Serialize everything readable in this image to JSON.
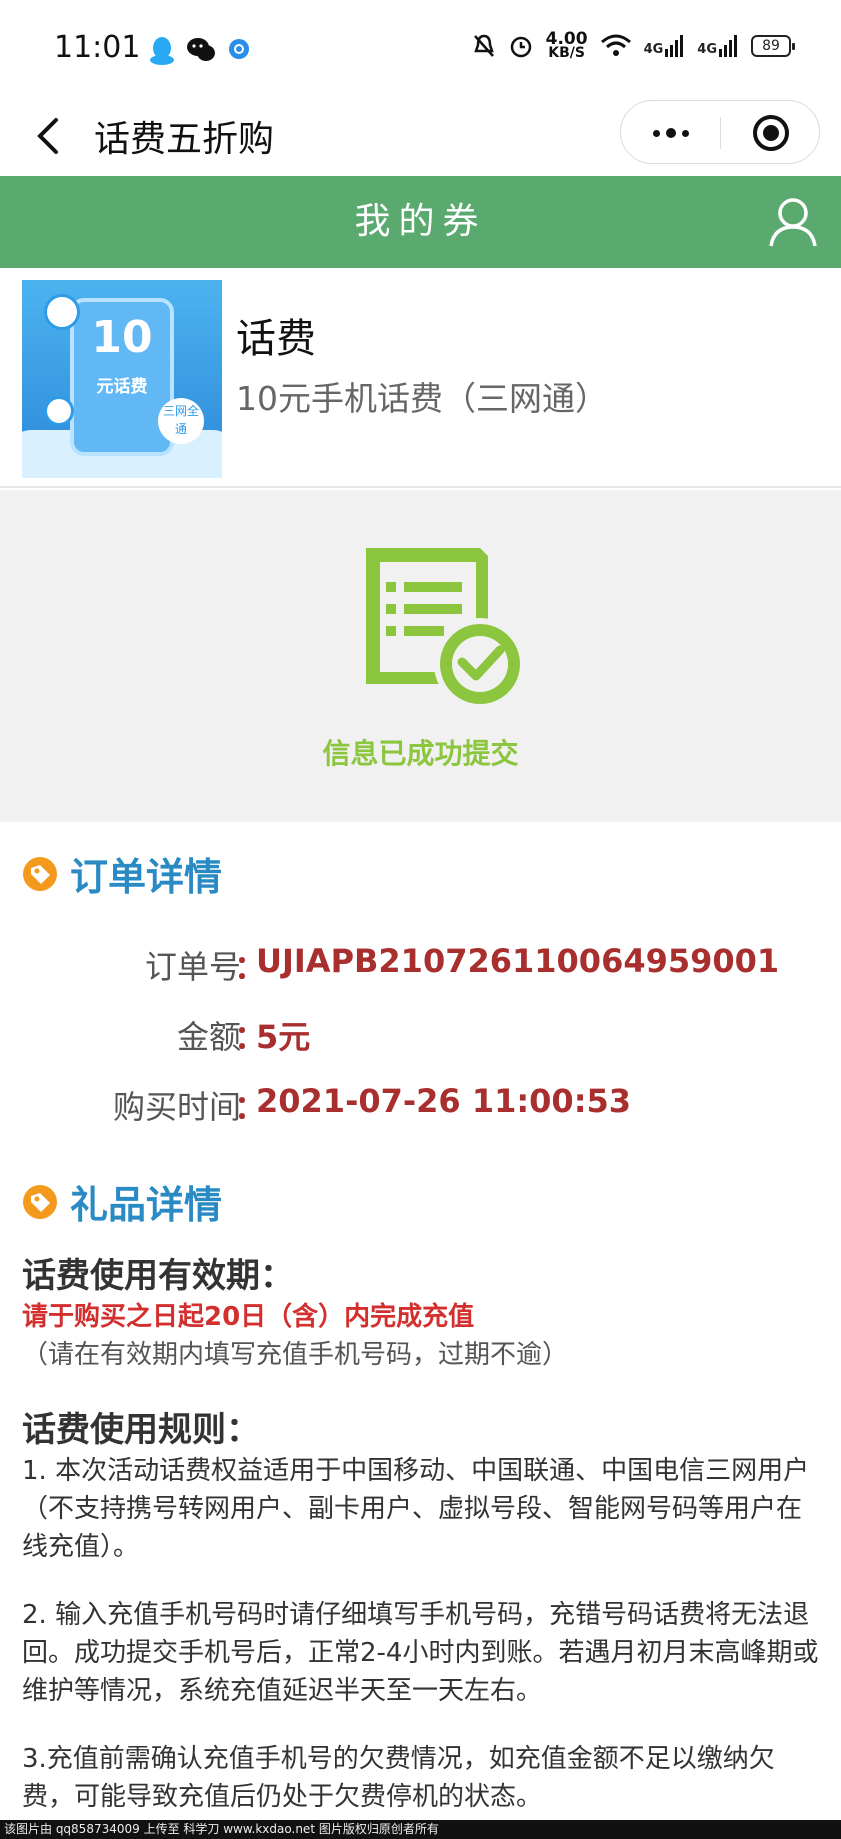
{
  "status_bar": {
    "time": "11:01",
    "speed_value": "4.00",
    "speed_unit": "KB/S",
    "network1": "4G",
    "network2": "4G",
    "battery": "89"
  },
  "nav": {
    "title": "话费五折购"
  },
  "header": {
    "title": "我的券"
  },
  "product": {
    "thumb_amount": "10",
    "thumb_caption": "元话费",
    "thumb_badge": "三网全通",
    "name": "话费",
    "description": "10元手机话费（三网通）"
  },
  "success": {
    "message": "信息已成功提交"
  },
  "order": {
    "section_title": "订单详情",
    "rows": [
      {
        "label": "订单号",
        "value": "UJIAPB210726110064959001"
      },
      {
        "label": "金额",
        "value": "5元"
      },
      {
        "label": "购买时间",
        "value": "2021-07-26 11:00:53"
      }
    ],
    "colon": "："
  },
  "gift": {
    "section_title": "礼品详情",
    "validity_heading": "话费使用有效期：",
    "validity_red": "请于购买之日起20日（含）内完成充值",
    "validity_note": "（请在有效期内填写充值手机号码，过期不逾）",
    "rules_heading": "话费使用规则：",
    "rules": [
      "1. 本次活动话费权益适用于中国移动、中国联通、中国电信三网用户（不支持携号转网用户、副卡用户、虚拟号段、智能网号码等用户在线充值）。",
      "2. 输入充值手机号码时请仔细填写手机号码，充错号码话费将无法退回。成功提交手机号后，正常2-4小时内到账。若遇月初月末高峰期或维护等情况，系统充值延迟半天至一天左右。",
      "3.充值前需确认充值手机号的欠费情况，如充值金额不足以缴纳欠费，可能导致充值后仍处于欠费停机的状态。"
    ]
  },
  "watermark": "该图片由 qq858734009 上传至 科学刀 www.kxdao.net 图片版权归原创者所有",
  "colors": {
    "green": "#5aa96f",
    "accent_blue": "#2a8bc4",
    "value_red": "#a92e2e",
    "success_green": "#8cc63f"
  }
}
